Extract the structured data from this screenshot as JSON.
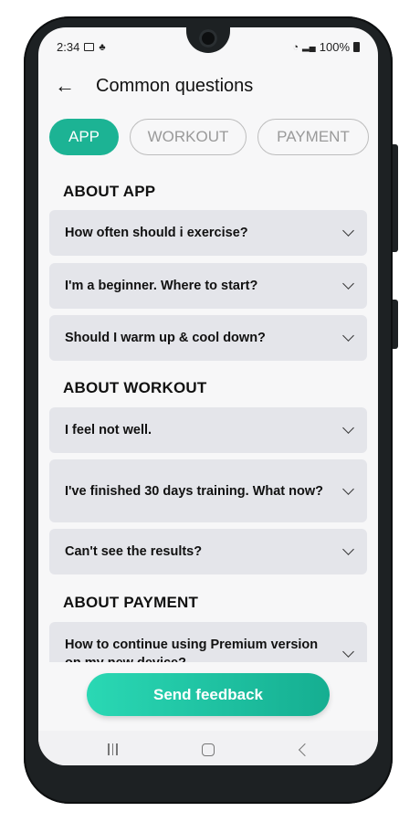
{
  "status": {
    "time": "2:34",
    "battery": "100%",
    "left_icons": [
      "gallery-icon",
      "sync-icon"
    ],
    "right_icons": [
      "wifi-icon",
      "signal-icon",
      "battery-icon"
    ]
  },
  "header": {
    "title": "Common questions",
    "back_icon": "arrow-left-icon"
  },
  "tabs": [
    {
      "label": "APP",
      "active": true
    },
    {
      "label": "WORKOUT",
      "active": false
    },
    {
      "label": "PAYMENT",
      "active": false
    }
  ],
  "sections": {
    "app": {
      "title": "ABOUT APP",
      "questions": [
        "How often should i exercise?",
        "I'm a beginner. Where to start?",
        "Should I warm up & cool down?"
      ]
    },
    "workout": {
      "title": "ABOUT WORKOUT",
      "questions": [
        "I feel not well.",
        "I've finished 30 days training. What now?",
        "Can't see the results?"
      ]
    },
    "payment": {
      "title": "ABOUT PAYMENT",
      "questions": [
        "How to continue using Premium version on my new device?"
      ]
    }
  },
  "feedback_label": "Send feedback",
  "colors": {
    "accent": "#1cb394",
    "card": "#e4e5ea",
    "background": "#f7f7f8"
  }
}
